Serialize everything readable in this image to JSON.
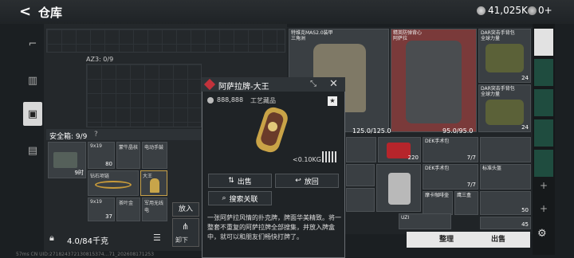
{
  "header": {
    "title": "仓库",
    "money": "41,025K",
    "gems": "0+"
  },
  "left_panel": {
    "container_label": "AZ3: 0/9",
    "safe_box_label": "安全箱: 9/9",
    "safe_box_help": "?",
    "cells": [
      {
        "label": "",
        "count": "9时"
      },
      {
        "label": "9x19",
        "count": "80"
      },
      {
        "label": "蒙牛晶核",
        "count": ""
      },
      {
        "label": "电动手鼓",
        "count": ""
      },
      {
        "label": "钻石项链",
        "count": ""
      },
      {
        "label": "大王",
        "count": ""
      },
      {
        "label": "9x19",
        "count": "37"
      },
      {
        "label": "茶叶金",
        "count": ""
      },
      {
        "label": "军用无线电",
        "count": ""
      }
    ],
    "putin_label": "放入",
    "unload_label": "卸下",
    "weight": "4.0/84千克"
  },
  "card": {
    "title": "阿萨拉牌-大王",
    "price": "888,888",
    "category": "工艺藏品",
    "weight": "<0.10KG",
    "buttons": {
      "sell": "出售",
      "put_back": "放回",
      "search": "搜索关联"
    },
    "description": "一张阿萨拉风情的扑克牌，牌面华美精致。将一整套不重复的阿萨拉牌全部搜集，并放入牌盒中，就可以和朋友们畅快打牌了。"
  },
  "right_panel": {
    "items": [
      {
        "label": "特维克MAS2.0装甲\n三角洲",
        "count": ""
      },
      {
        "label": "精英防弹背心\n阿萨拉",
        "count": ""
      },
      {
        "label": "DAR突击手背包\n全球力量",
        "count": "24"
      },
      {
        "label": "DAR突击手背包\n全球力量",
        "count": "24"
      },
      {
        "label": "",
        "count": "125.0/125.0"
      },
      {
        "label": "",
        "count": "95.0/95.0"
      },
      {
        "label": "DEK手术包",
        "count": "7/7"
      },
      {
        "label": "",
        "count": "220"
      },
      {
        "label": "",
        "count": ""
      },
      {
        "label": "DEK手术包",
        "count": "7/7"
      },
      {
        "label": "标准头盔",
        "count": ""
      },
      {
        "label": "",
        "count": ""
      },
      {
        "label": "",
        "count": ""
      },
      {
        "label": "信号棒",
        "count": ""
      },
      {
        "label": "摩卡咖啡壶",
        "count": ""
      },
      {
        "label": "鹰三盒",
        "count": "50"
      },
      {
        "label": "UZI",
        "count": ""
      },
      {
        "label": "9x19mm",
        "count": "45"
      }
    ],
    "durability_1": "125.0/125.0",
    "durability_2": "95.0/95.0"
  },
  "actions": {
    "sort": "整理",
    "sell": "出售"
  },
  "footer": "57ms   CN UID:271824372130815374…71_202608171253"
}
